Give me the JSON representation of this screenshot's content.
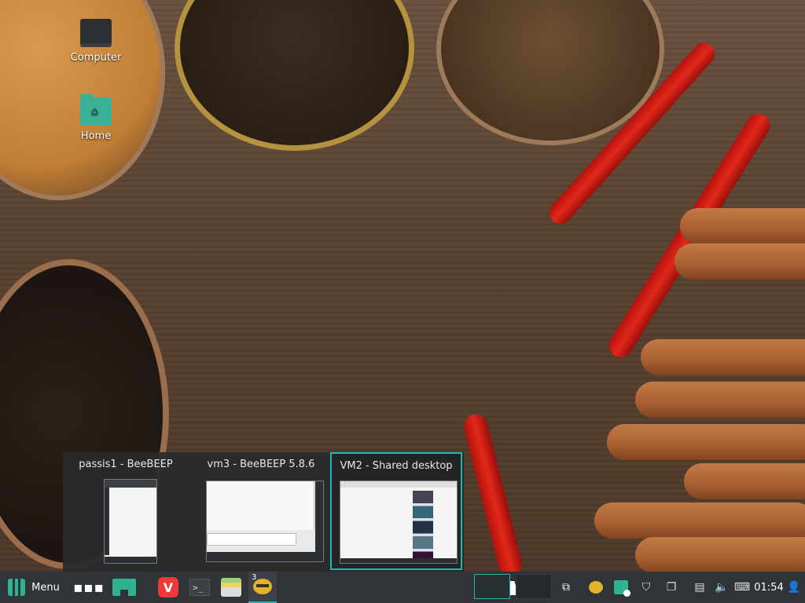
{
  "desktop": {
    "icons": [
      {
        "label": "Computer",
        "icon": "computer-monitor-icon"
      },
      {
        "label": "Home",
        "icon": "home-folder-icon"
      }
    ]
  },
  "window_previews": [
    {
      "title": "passis1 - BeeBEEP",
      "active": false
    },
    {
      "title": "vm3 - BeeBEEP 5.8.6",
      "active": false
    },
    {
      "title": "VM2 - Shared desktop",
      "active": true
    }
  ],
  "taskbar": {
    "menu_label": "Menu",
    "launchers": [
      "show-apps-icon",
      "show-desktop-icon",
      "vivaldi-browser-icon",
      "terminal-icon",
      "files-icon"
    ],
    "vivaldi_glyph": "V",
    "terminal_glyph": ">_",
    "beebeep_window_count": "3",
    "workspaces": 2,
    "tray": [
      "beebeep-tray-icon",
      "mintupdate-icon",
      "shield-icon",
      "notes-icon",
      "network-icon",
      "volume-icon",
      "keyboard-layout-icon",
      "user-icon"
    ],
    "clock": "01:54"
  },
  "colors": {
    "accent": "#2cb1b3",
    "mint": "#2fb192",
    "taskbar": "#303338"
  }
}
